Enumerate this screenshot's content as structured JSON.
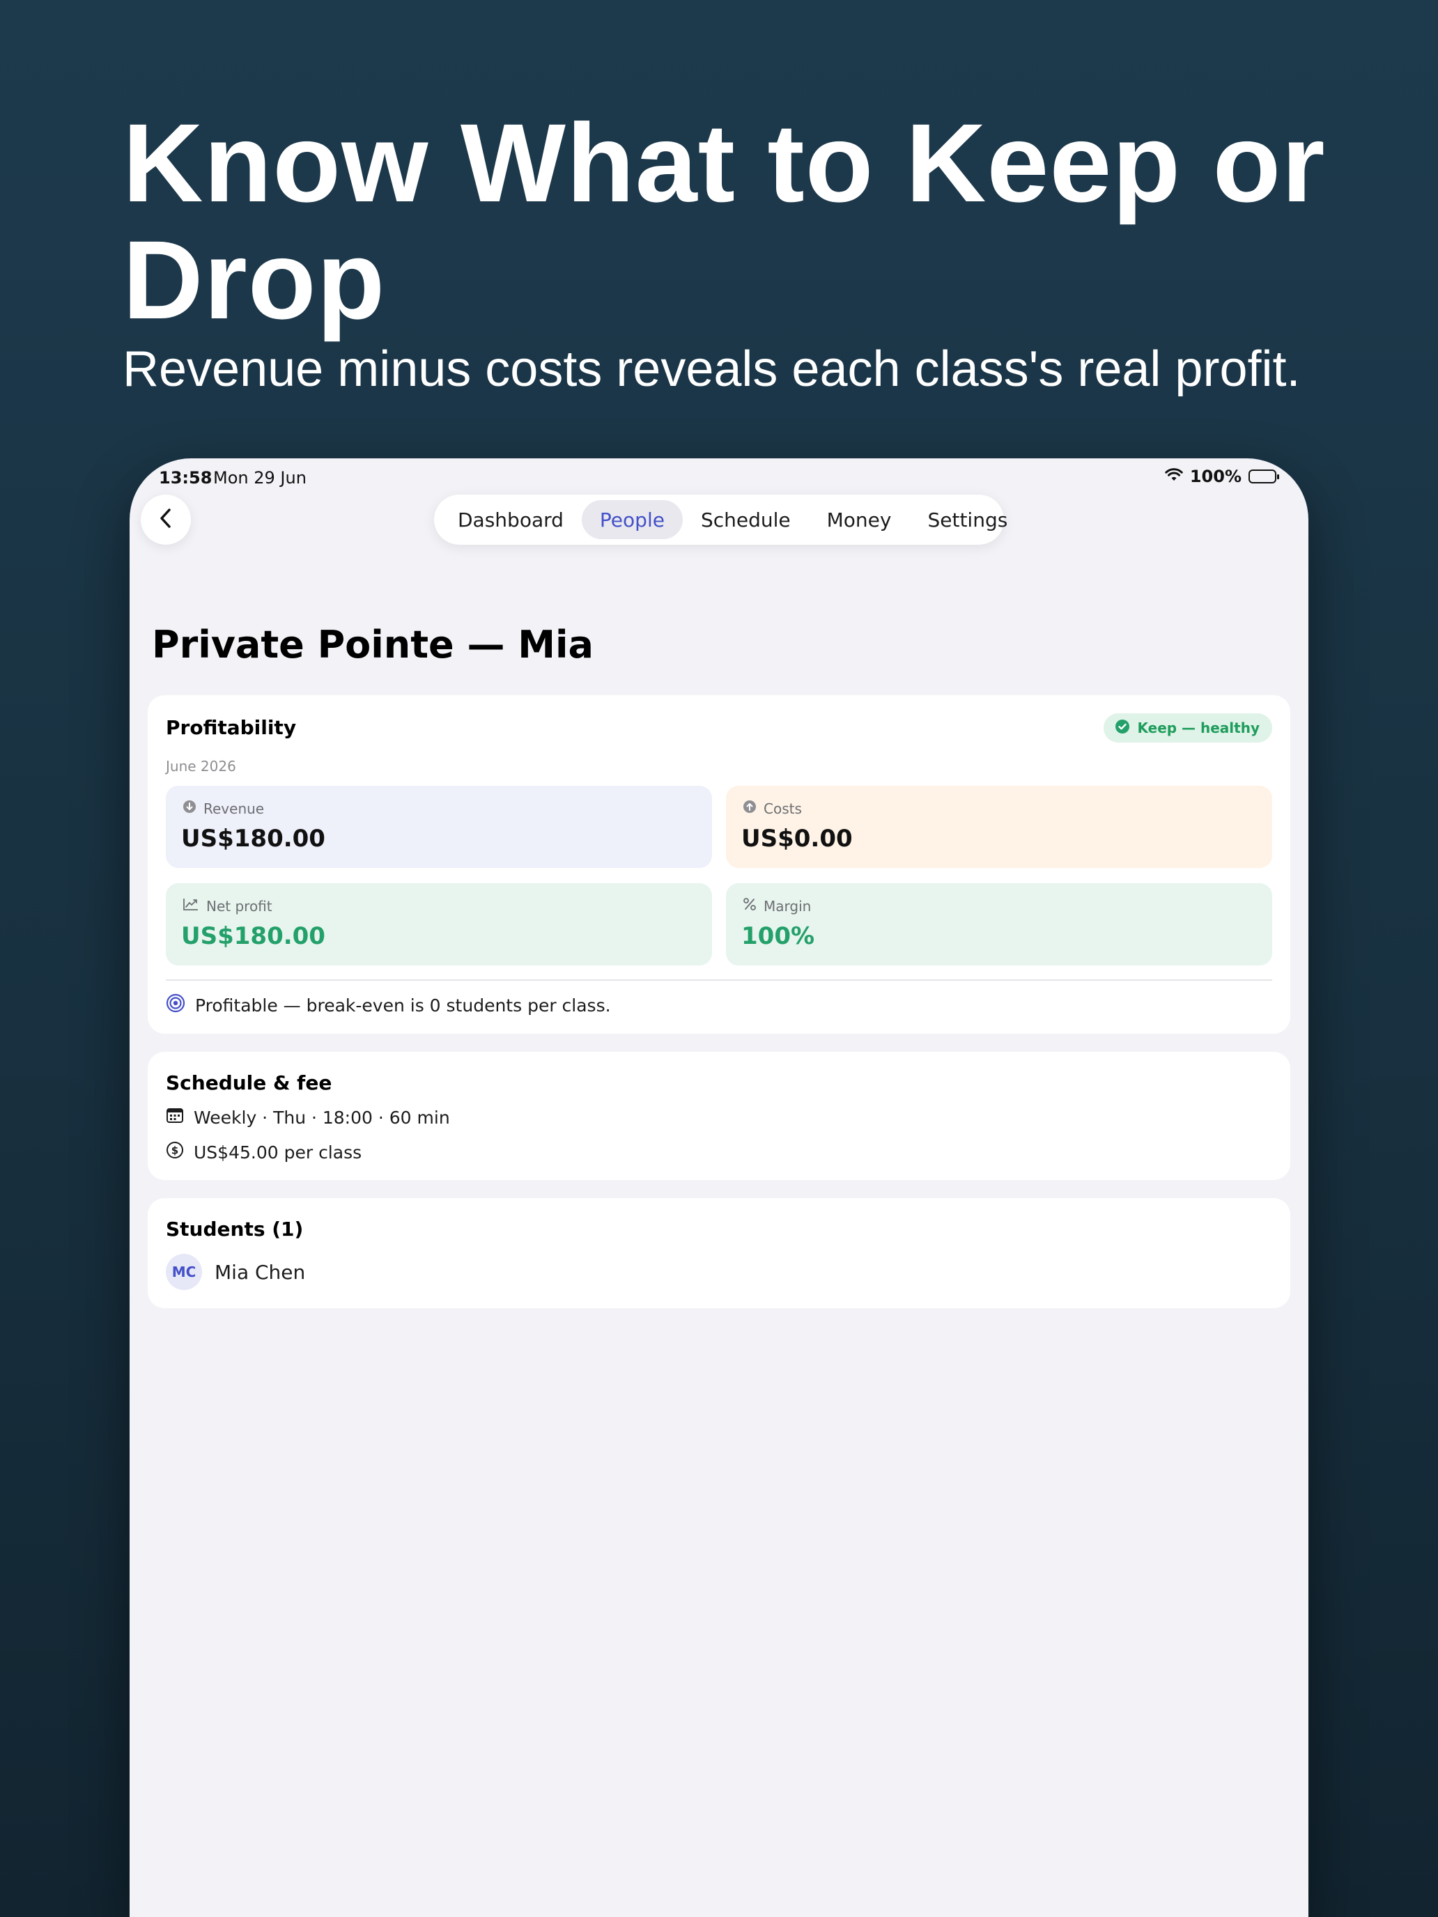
{
  "hero": {
    "headline": "Know What to Keep or Drop",
    "subheadline": "Revenue minus costs reveals each class's real profit."
  },
  "status_bar": {
    "time": "13:58",
    "date": "Mon 29 Jun",
    "battery": "100%"
  },
  "nav": {
    "tabs": [
      {
        "label": "Dashboard",
        "active": false
      },
      {
        "label": "People",
        "active": true
      },
      {
        "label": "Schedule",
        "active": false
      },
      {
        "label": "Money",
        "active": false
      },
      {
        "label": "Settings",
        "active": false
      }
    ]
  },
  "page": {
    "title": "Private Pointe — Mia"
  },
  "profitability": {
    "title": "Profitability",
    "period": "June 2026",
    "badge": "Keep — healthy",
    "revenue": {
      "label": "Revenue",
      "value": "US$180.00"
    },
    "costs": {
      "label": "Costs",
      "value": "US$0.00"
    },
    "net_profit": {
      "label": "Net profit",
      "value": "US$180.00"
    },
    "margin": {
      "label": "Margin",
      "value": "100%"
    },
    "note": "Profitable — break-even is 0 students per class."
  },
  "schedule": {
    "title": "Schedule & fee",
    "recurrence": "Weekly · Thu · 18:00 · 60 min",
    "fee": "US$45.00 per class"
  },
  "students": {
    "title": "Students (1)",
    "list": [
      {
        "initials": "MC",
        "name": "Mia Chen"
      }
    ]
  },
  "colors": {
    "accent": "#4450c8",
    "positive": "#24a06a",
    "background": "#f2f2f7"
  }
}
